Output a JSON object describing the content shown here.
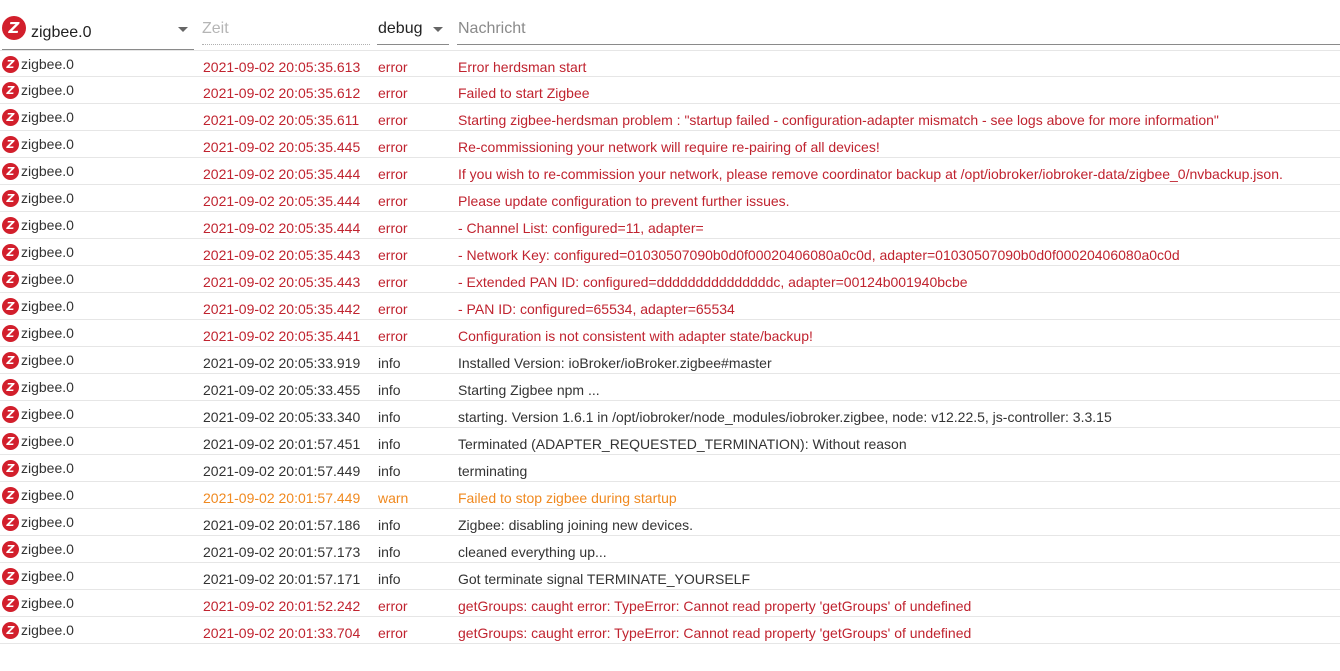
{
  "filters": {
    "adapter": "zigbee.0",
    "time_placeholder": "Zeit",
    "level": "debug",
    "message_placeholder": "Nachricht"
  },
  "colors": {
    "error": "#c0232f",
    "warn": "#f0891f",
    "info": "#333333",
    "logo": "#d21f2c"
  },
  "logo_letter": "Z",
  "log": [
    {
      "source": "zigbee.0",
      "time": "2021-09-02 20:05:35.613",
      "level": "error",
      "message": "Error herdsman start"
    },
    {
      "source": "zigbee.0",
      "time": "2021-09-02 20:05:35.612",
      "level": "error",
      "message": "Failed to start Zigbee"
    },
    {
      "source": "zigbee.0",
      "time": "2021-09-02 20:05:35.611",
      "level": "error",
      "message": "Starting zigbee-herdsman problem : \"startup failed - configuration-adapter mismatch - see logs above for more information\""
    },
    {
      "source": "zigbee.0",
      "time": "2021-09-02 20:05:35.445",
      "level": "error",
      "message": "Re-commissioning your network will require re-pairing of all devices!"
    },
    {
      "source": "zigbee.0",
      "time": "2021-09-02 20:05:35.444",
      "level": "error",
      "message": "If you wish to re-commission your network, please remove coordinator backup at /opt/iobroker/iobroker-data/zigbee_0/nvbackup.json."
    },
    {
      "source": "zigbee.0",
      "time": "2021-09-02 20:05:35.444",
      "level": "error",
      "message": "Please update configuration to prevent further issues."
    },
    {
      "source": "zigbee.0",
      "time": "2021-09-02 20:05:35.444",
      "level": "error",
      "message": "- Channel List: configured=11, adapter="
    },
    {
      "source": "zigbee.0",
      "time": "2021-09-02 20:05:35.443",
      "level": "error",
      "message": "- Network Key: configured=01030507090b0d0f00020406080a0c0d, adapter=01030507090b0d0f00020406080a0c0d"
    },
    {
      "source": "zigbee.0",
      "time": "2021-09-02 20:05:35.443",
      "level": "error",
      "message": "- Extended PAN ID: configured=dddddddddddddddc, adapter=00124b001940bcbe"
    },
    {
      "source": "zigbee.0",
      "time": "2021-09-02 20:05:35.442",
      "level": "error",
      "message": "- PAN ID: configured=65534, adapter=65534"
    },
    {
      "source": "zigbee.0",
      "time": "2021-09-02 20:05:35.441",
      "level": "error",
      "message": "Configuration is not consistent with adapter state/backup!"
    },
    {
      "source": "zigbee.0",
      "time": "2021-09-02 20:05:33.919",
      "level": "info",
      "message": "Installed Version: ioBroker/ioBroker.zigbee#master"
    },
    {
      "source": "zigbee.0",
      "time": "2021-09-02 20:05:33.455",
      "level": "info",
      "message": "Starting Zigbee npm ..."
    },
    {
      "source": "zigbee.0",
      "time": "2021-09-02 20:05:33.340",
      "level": "info",
      "message": "starting. Version 1.6.1 in /opt/iobroker/node_modules/iobroker.zigbee, node: v12.22.5, js-controller: 3.3.15"
    },
    {
      "source": "zigbee.0",
      "time": "2021-09-02 20:01:57.451",
      "level": "info",
      "message": "Terminated (ADAPTER_REQUESTED_TERMINATION): Without reason"
    },
    {
      "source": "zigbee.0",
      "time": "2021-09-02 20:01:57.449",
      "level": "info",
      "message": "terminating"
    },
    {
      "source": "zigbee.0",
      "time": "2021-09-02 20:01:57.449",
      "level": "warn",
      "message": "Failed to stop zigbee during startup"
    },
    {
      "source": "zigbee.0",
      "time": "2021-09-02 20:01:57.186",
      "level": "info",
      "message": "Zigbee: disabling joining new devices."
    },
    {
      "source": "zigbee.0",
      "time": "2021-09-02 20:01:57.173",
      "level": "info",
      "message": "cleaned everything up..."
    },
    {
      "source": "zigbee.0",
      "time": "2021-09-02 20:01:57.171",
      "level": "info",
      "message": "Got terminate signal TERMINATE_YOURSELF"
    },
    {
      "source": "zigbee.0",
      "time": "2021-09-02 20:01:52.242",
      "level": "error",
      "message": "getGroups: caught error: TypeError: Cannot read property 'getGroups' of undefined"
    },
    {
      "source": "zigbee.0",
      "time": "2021-09-02 20:01:33.704",
      "level": "error",
      "message": "getGroups: caught error: TypeError: Cannot read property 'getGroups' of undefined"
    }
  ]
}
